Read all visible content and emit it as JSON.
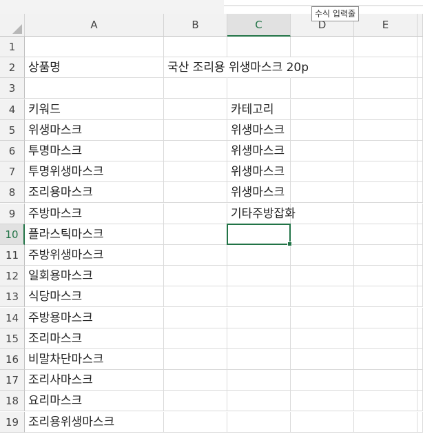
{
  "tooltip": "수식 입력줄",
  "columns": [
    "A",
    "B",
    "C",
    "D",
    "E"
  ],
  "active_column": "C",
  "rows": [
    "1",
    "2",
    "3",
    "4",
    "5",
    "6",
    "7",
    "8",
    "9",
    "10",
    "11",
    "12",
    "13",
    "14",
    "15",
    "16",
    "17",
    "18",
    "19"
  ],
  "active_row": "10",
  "selected_cell": "C10",
  "cells": {
    "A2": "상품명",
    "B2": "국산 조리용 위생마스크 20p",
    "A4": "키워드",
    "C4": "카테고리",
    "A5": "위생마스크",
    "C5": "위생마스크",
    "A6": "투명마스크",
    "C6": "위생마스크",
    "A7": "투명위생마스크",
    "C7": "위생마스크",
    "A8": "조리용마스크",
    "C8": "위생마스크",
    "A9": "주방마스크",
    "C9": "기타주방잡화",
    "A10": "플라스틱마스크",
    "A11": "주방위생마스크",
    "A12": "일회용마스크",
    "A13": "식당마스크",
    "A14": "주방용마스크",
    "A15": "조리마스크",
    "A16": "비말차단마스크",
    "A17": "조리사마스크",
    "A18": "요리마스크",
    "A19": "조리용위생마스크"
  },
  "colors": {
    "accent": "#217346"
  }
}
